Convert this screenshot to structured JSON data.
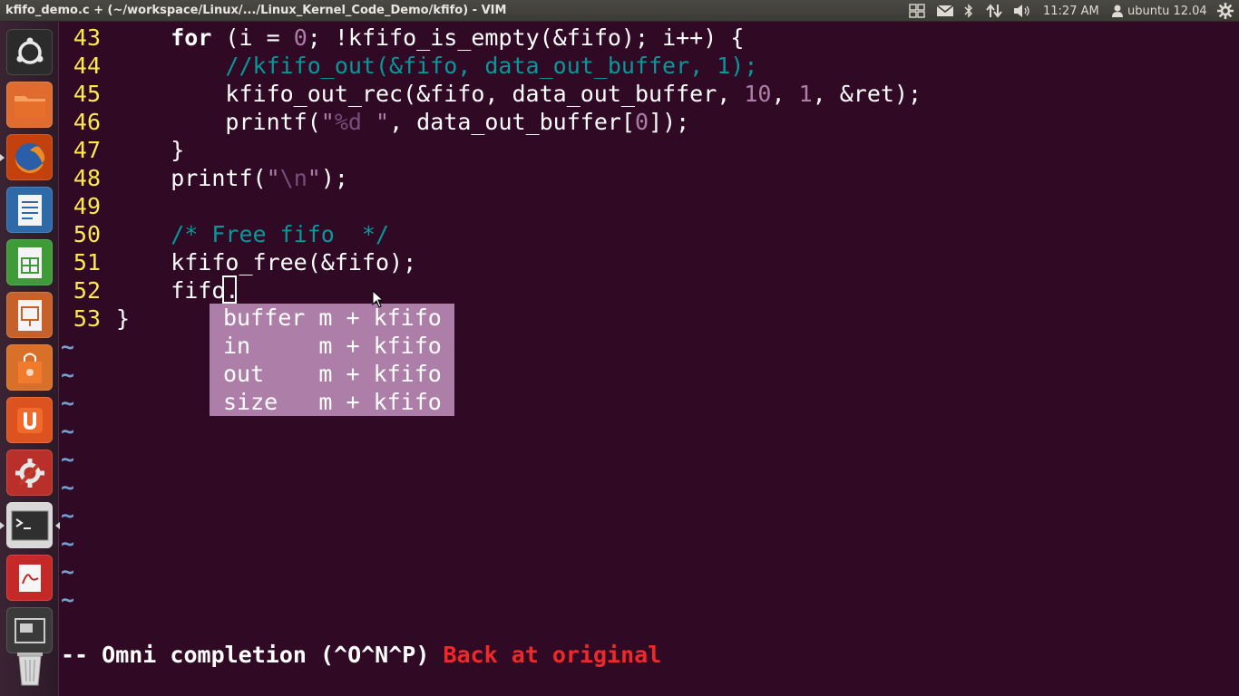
{
  "window": {
    "title": "kfifo_demo.c + (~/workspace/Linux/.../Linux_Kernel_Code_Demo/kfifo) - VIM"
  },
  "panel": {
    "clock": "11:27 AM",
    "user": "ubuntu 12.04",
    "icons": [
      "workspace-switcher-icon",
      "mail-icon",
      "bluetooth-icon",
      "network-icon",
      "volume-icon",
      "user-icon",
      "session-gear-icon"
    ]
  },
  "launcher": {
    "items": [
      {
        "name": "dash-home",
        "icon": "ubuntu-logo-icon"
      },
      {
        "name": "files",
        "icon": "folder-icon"
      },
      {
        "name": "firefox",
        "icon": "firefox-icon"
      },
      {
        "name": "writer",
        "icon": "libreoffice-writer-icon"
      },
      {
        "name": "calc",
        "icon": "libreoffice-calc-icon"
      },
      {
        "name": "impress",
        "icon": "libreoffice-impress-icon"
      },
      {
        "name": "software-center",
        "icon": "shopping-bag-icon"
      },
      {
        "name": "ubuntu-one",
        "icon": "ubuntu-one-icon"
      },
      {
        "name": "system-settings",
        "icon": "settings-icon"
      },
      {
        "name": "terminal",
        "icon": "terminal-icon"
      },
      {
        "name": "document-viewer",
        "icon": "pdf-viewer-icon"
      },
      {
        "name": "workspaces",
        "icon": "workspace-icon"
      },
      {
        "name": "trash",
        "icon": "trash-icon"
      }
    ]
  },
  "editor": {
    "lines": [
      {
        "num": "43"
      },
      {
        "num": "44"
      },
      {
        "num": "45"
      },
      {
        "num": "46"
      },
      {
        "num": "47"
      },
      {
        "num": "48"
      },
      {
        "num": "49"
      },
      {
        "num": "50"
      },
      {
        "num": "51"
      },
      {
        "num": "52"
      },
      {
        "num": "53"
      }
    ],
    "code": {
      "l43_a": "    ",
      "l43_for": "for",
      "l43_b": " (i = ",
      "l43_zero": "0",
      "l43_c": "; !kfifo_is_empty(&fifo); i++) {",
      "l44": "        //kfifo_out(&fifo, data_out_buffer, 1);",
      "l45_a": "        kfifo_out_rec(&fifo, data_out_buffer, ",
      "l45_n10": "10",
      "l45_b": ", ",
      "l45_n1": "1",
      "l45_c": ", &ret);",
      "l46_a": "        printf(",
      "l46_q1": "\"",
      "l46_fmt": "%d ",
      "l46_q2": "\"",
      "l46_b": ", data_out_buffer[",
      "l46_n0": "0",
      "l46_c": "]);",
      "l47": "    }",
      "l48_a": "    printf(",
      "l48_q1": "\"",
      "l48_esc": "\\n",
      "l48_q2": "\"",
      "l48_b": ");",
      "l49": "",
      "l50": "    /* Free fifo  */",
      "l51": "    kfifo_free(&fifo);",
      "l52": "    fifo.",
      "l53": "}"
    },
    "tilde": "~",
    "tilde_count": 10
  },
  "popup": {
    "items": [
      "buffer m + kfifo",
      "in     m + kfifo",
      "out    m + kfifo",
      "size   m + kfifo"
    ]
  },
  "status": {
    "mode": "-- Omni completion (^O^N^P) ",
    "message": "Back at original"
  },
  "colors": {
    "background": "#300a24",
    "line_number": "#fce94f",
    "comment": "#06989a",
    "number": "#ad7fa8",
    "popup": "#ad7fa8",
    "tilde": "#729fcf",
    "error": "#ef2929"
  }
}
